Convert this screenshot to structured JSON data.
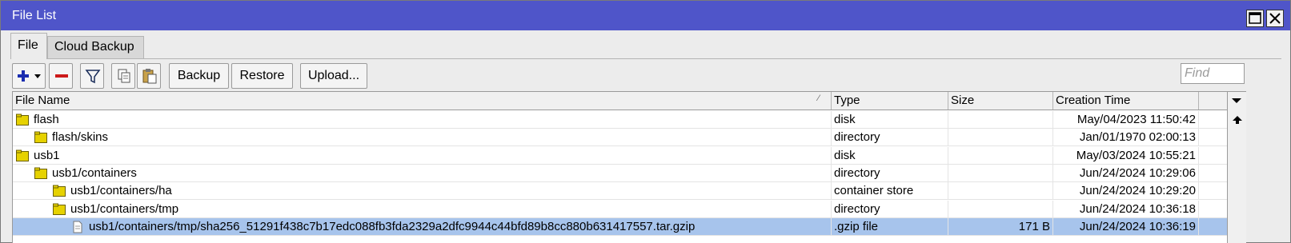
{
  "window": {
    "title": "File List"
  },
  "tabs": [
    {
      "label": "File"
    },
    {
      "label": "Cloud Backup"
    }
  ],
  "toolbar": {
    "add_icon": "plus-icon",
    "remove_icon": "minus-icon",
    "filter_icon": "funnel-icon",
    "copy_icon": "copy-icon",
    "paste_icon": "paste-icon",
    "backup_label": "Backup",
    "restore_label": "Restore",
    "upload_label": "Upload...",
    "find_placeholder": "Find"
  },
  "table": {
    "columns": [
      "File Name",
      "Type",
      "Size",
      "Creation Time"
    ],
    "rows": [
      {
        "name": "flash",
        "type": "disk",
        "size": "",
        "time": "May/04/2023 11:50:42",
        "icon": "folder-icon",
        "level": 0,
        "selected": false
      },
      {
        "name": "flash/skins",
        "type": "directory",
        "size": "",
        "time": "Jan/01/1970 02:00:13",
        "icon": "folder-icon",
        "level": 1,
        "selected": false
      },
      {
        "name": "usb1",
        "type": "disk",
        "size": "",
        "time": "May/03/2024 10:55:21",
        "icon": "folder-icon",
        "level": 0,
        "selected": false
      },
      {
        "name": "usb1/containers",
        "type": "directory",
        "size": "",
        "time": "Jun/24/2024 10:29:06",
        "icon": "folder-icon",
        "level": 1,
        "selected": false
      },
      {
        "name": "usb1/containers/ha",
        "type": "container store",
        "size": "",
        "time": "Jun/24/2024 10:29:20",
        "icon": "folder-icon",
        "level": 2,
        "selected": false
      },
      {
        "name": "usb1/containers/tmp",
        "type": "directory",
        "size": "",
        "time": "Jun/24/2024 10:36:18",
        "icon": "folder-icon",
        "level": 2,
        "selected": false
      },
      {
        "name": "usb1/containers/tmp/sha256_51291f438c7b17edc088fb3fda2329a2dfc9944c44bfd89b8cc880b631417557.tar.gzip",
        "type": ".gzip file",
        "size": "171 B",
        "time": "Jun/24/2024 10:36:19",
        "icon": "file-icon",
        "level": 3,
        "selected": true
      }
    ]
  },
  "colors": {
    "titlebar": "#4f55c9",
    "selection": "#a7c4ec",
    "folder": "#e6d200"
  }
}
